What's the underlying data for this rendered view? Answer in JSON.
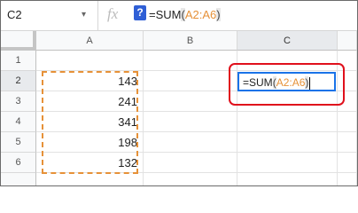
{
  "namebox": {
    "value": "C2",
    "caret": "▾"
  },
  "formula_bar": {
    "fx": "fx",
    "help": "?",
    "prefix": "=SUM",
    "open": "(",
    "ref": "A2:A6",
    "close": ")"
  },
  "columns": [
    "A",
    "B",
    "C"
  ],
  "rows": [
    "1",
    "2",
    "3",
    "4",
    "5",
    "6"
  ],
  "cells_a": [
    "",
    "143",
    "241",
    "341",
    "198",
    "132"
  ],
  "active_cell": {
    "prefix": "=SUM",
    "open": "(",
    "ref": "A2:A6",
    "close": ")"
  },
  "colors": {
    "range_highlight": "#e69138",
    "active_border": "#1a73e8",
    "annotation": "#e0101c",
    "help_badge": "#2f5fd6"
  }
}
